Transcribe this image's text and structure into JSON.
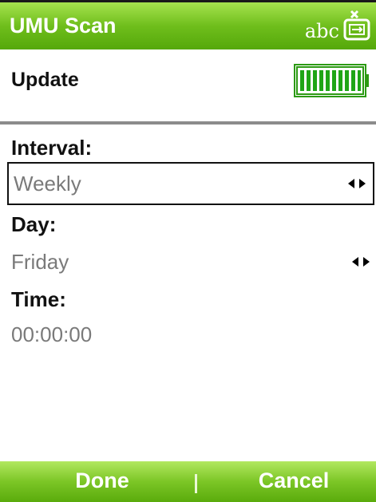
{
  "title_bar": {
    "title": "UMU Scan",
    "input_mode": "abc",
    "input_icon": "keyboard-switch-icon",
    "background": "#6fbe1c"
  },
  "update": {
    "label": "Update",
    "status_icon": "battery-full-icon"
  },
  "fields": {
    "interval": {
      "label": "Interval:",
      "value": "Weekly"
    },
    "day": {
      "label": "Day:",
      "value": "Friday"
    },
    "time": {
      "label": "Time:",
      "value": "00:00:00"
    }
  },
  "softkeys": {
    "left": "Done",
    "right": "Cancel"
  },
  "colors": {
    "accent": "#6fbe1c",
    "text": "#111111",
    "value_text": "#7a7a7a"
  }
}
